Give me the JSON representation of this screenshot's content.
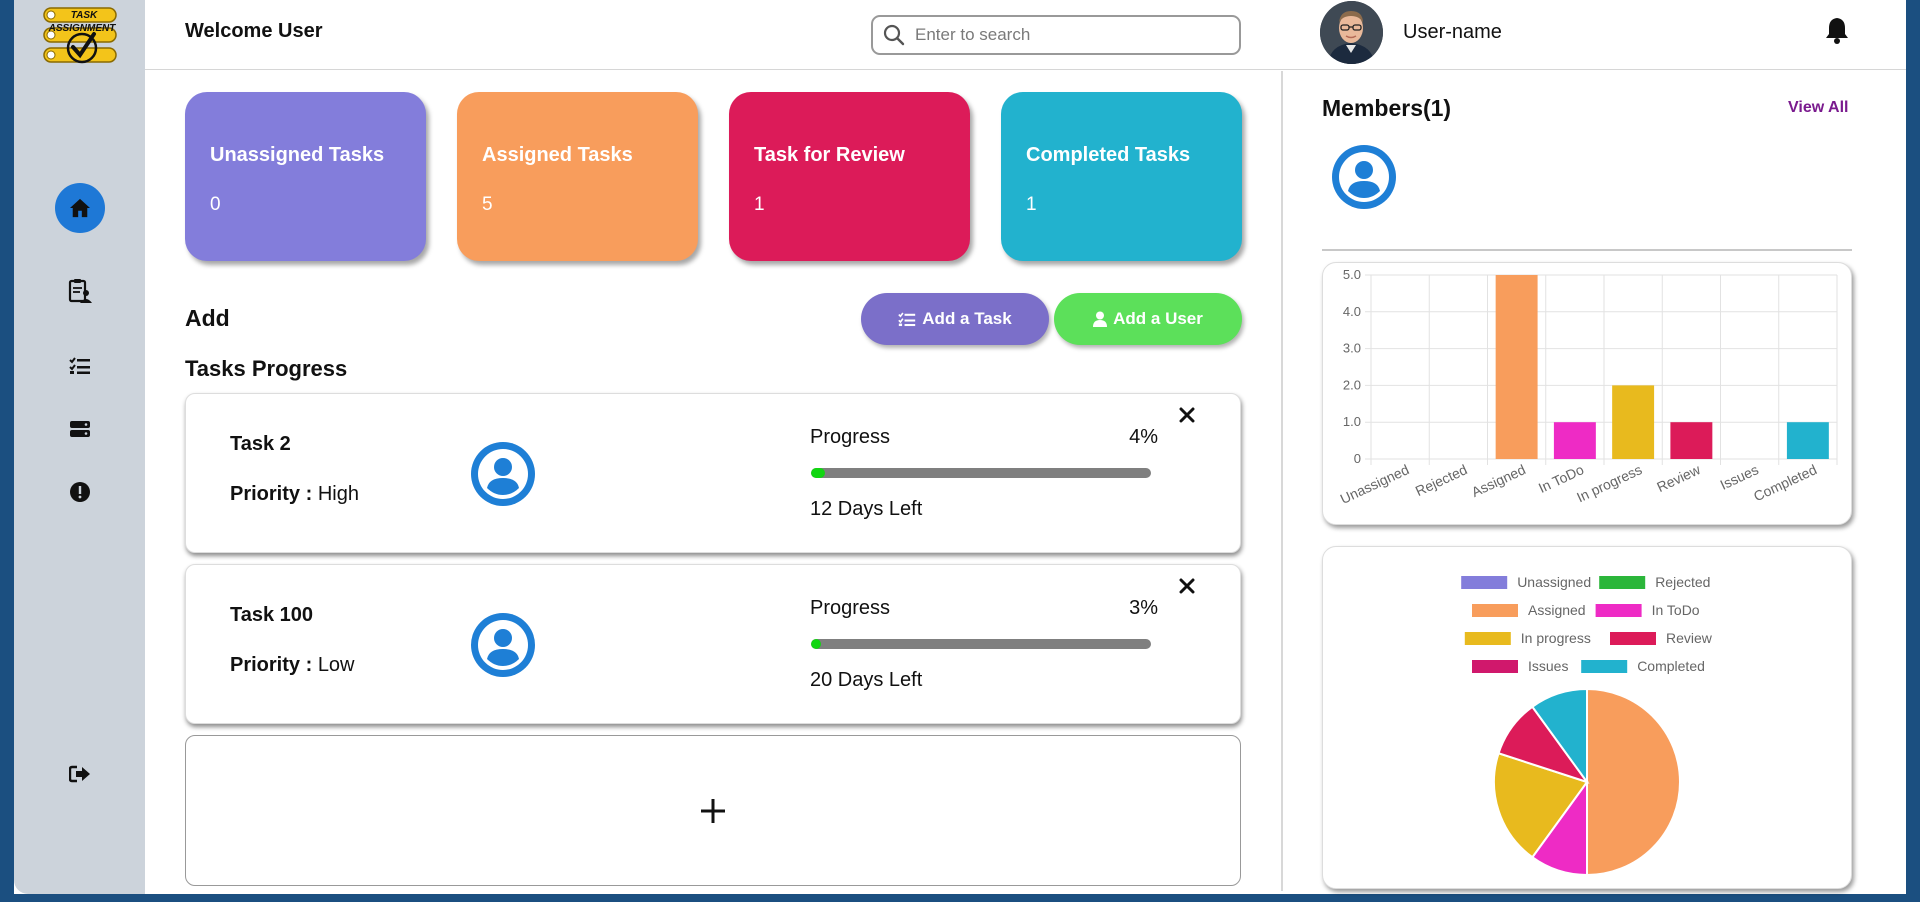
{
  "header": {
    "welcome": "Welcome User",
    "search_placeholder": "Enter to search",
    "username": "User-name"
  },
  "logo": {
    "line1": "TASK",
    "line2": "ASSIGNMENT"
  },
  "sidebar": {
    "items": [
      {
        "icon": "home-icon",
        "active": true
      },
      {
        "icon": "clipboard-users-icon",
        "active": false
      },
      {
        "icon": "task-list-icon",
        "active": false
      },
      {
        "icon": "server-icon",
        "active": false
      },
      {
        "icon": "alert-circle-icon",
        "active": false
      },
      {
        "icon": "sign-out-icon",
        "active": false
      }
    ]
  },
  "cards": [
    {
      "title": "Unassigned Tasks",
      "count": "0",
      "color": "#837ddb"
    },
    {
      "title": "Assigned Tasks",
      "count": "5",
      "color": "#f89d5c"
    },
    {
      "title": "Task for Review",
      "count": "1",
      "color": "#dc1b59"
    },
    {
      "title": "Completed Tasks",
      "count": "1",
      "color": "#22b2ce"
    }
  ],
  "add_section": {
    "title": "Add",
    "add_task_label": "Add a Task",
    "add_user_label": "Add a User"
  },
  "progress_section": {
    "title": "Tasks Progress",
    "tasks": [
      {
        "name": "Task 2",
        "priority_label": "Priority :",
        "priority": "High",
        "progress_label": "Progress",
        "percent_text": "4%",
        "percent": 4,
        "days_left": "12 Days Left"
      },
      {
        "name": "Task 100",
        "priority_label": "Priority :",
        "priority": "Low",
        "progress_label": "Progress",
        "percent_text": "3%",
        "percent": 3,
        "days_left": "20 Days Left"
      }
    ],
    "add_symbol": "+"
  },
  "members": {
    "title": "Members(1)",
    "view_all": "View All"
  },
  "chart_data": [
    {
      "type": "bar",
      "categories": [
        "Unassigned",
        "Rejected",
        "Assigned",
        "In ToDo",
        "In progress",
        "Review",
        "Issues",
        "Completed"
      ],
      "values": [
        0,
        0,
        5,
        1,
        2,
        1,
        0,
        1
      ],
      "colors": [
        "#837ddb",
        "#2bb63a",
        "#f89d5c",
        "#ee2bc5",
        "#e8ba1e",
        "#dc1b59",
        "#d0186c",
        "#22b2ce"
      ],
      "ylim": [
        0,
        5
      ],
      "yticks": [
        "0",
        "1.0",
        "2.0",
        "3.0",
        "4.0",
        "5.0"
      ],
      "grid": true,
      "legend": "none"
    },
    {
      "type": "pie",
      "labels": [
        "Unassigned",
        "Rejected",
        "Assigned",
        "In ToDo",
        "In progress",
        "Review",
        "Issues",
        "Completed"
      ],
      "values": [
        0,
        0,
        5,
        1,
        2,
        1,
        0,
        1
      ],
      "colors": [
        "#837ddb",
        "#2bb63a",
        "#f89d5c",
        "#ee2bc5",
        "#e8ba1e",
        "#dc1b59",
        "#d0186c",
        "#22b2ce"
      ],
      "legend": "top"
    }
  ]
}
